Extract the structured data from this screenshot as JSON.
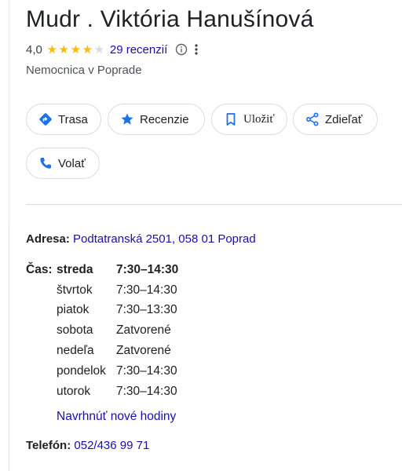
{
  "place": {
    "name": "Mudr . Viktória Hanušínová",
    "rating": "4,0",
    "stars_filled": 4,
    "stars_total": 5,
    "reviews_label": "29 recenzií",
    "category": "Nemocnica v Poprade"
  },
  "actions": {
    "route": "Trasa",
    "reviews": "Recenzie",
    "save": "Uložiť",
    "share": "Zdieľať",
    "call": "Volať"
  },
  "details": {
    "address_label": "Adresa:",
    "address_value": "Podtatranská 2501, 058 01 Poprad",
    "hours_label": "Čas:",
    "hours": [
      {
        "day": "streda",
        "time": "7:30–14:30"
      },
      {
        "day": "štvrtok",
        "time": "7:30–14:30"
      },
      {
        "day": "piatok",
        "time": "7:30–13:30"
      },
      {
        "day": "sobota",
        "time": "Zatvorené"
      },
      {
        "day": "nedeľa",
        "time": "Zatvorené"
      },
      {
        "day": "pondelok",
        "time": "7:30–14:30"
      },
      {
        "day": "utorok",
        "time": "7:30–14:30"
      }
    ],
    "suggest_hours": "Navrhnúť nové hodiny",
    "phone_label": "Telefón:",
    "phone_value": "052/436 99 71"
  },
  "colors": {
    "star": "#fbbc04",
    "link": "#1a0dab",
    "accent_icon": "#1a73e8"
  },
  "icons": {
    "route": "directions-diamond-icon",
    "reviews": "star-icon",
    "save": "bookmark-icon",
    "share": "share-icon",
    "call": "phone-icon",
    "info": "info-icon",
    "more": "more-vertical-icon"
  }
}
